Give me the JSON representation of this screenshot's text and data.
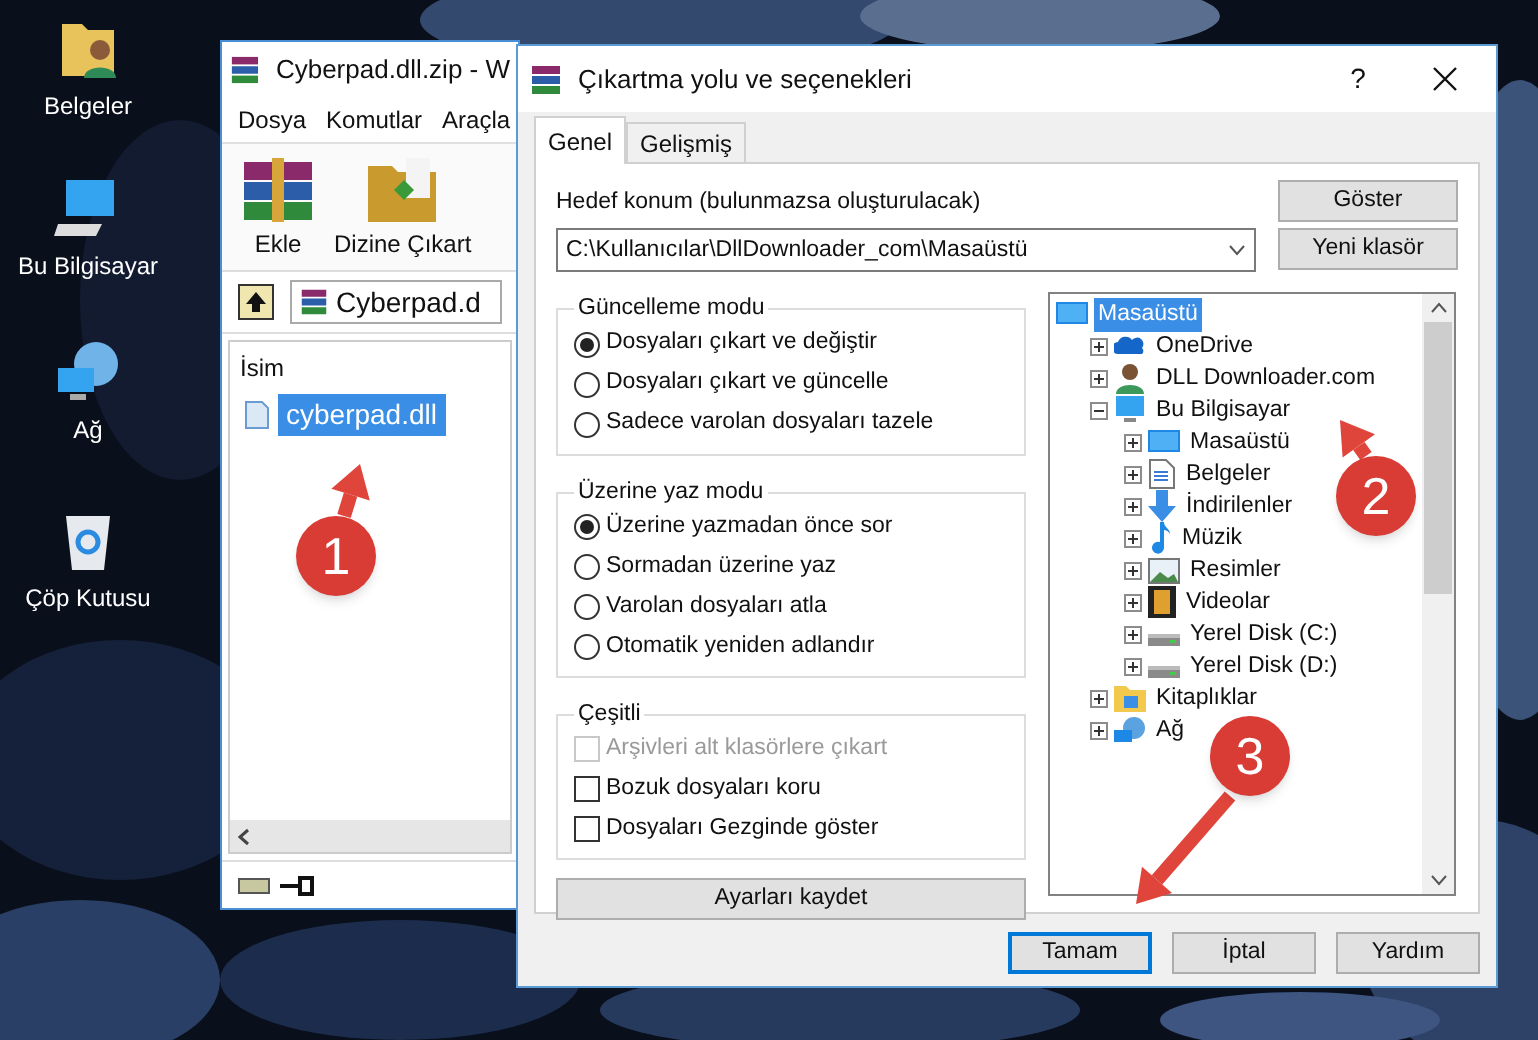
{
  "desktop_icons": [
    {
      "label": "Belgeler",
      "kind": "documents"
    },
    {
      "label": "Bu Bilgisayar",
      "kind": "computer"
    },
    {
      "label": "Ağ",
      "kind": "network"
    },
    {
      "label": "Çöp Kutusu",
      "kind": "recycle"
    }
  ],
  "archiver": {
    "title": "Cyberpad.dll.zip - W",
    "menu": [
      "Dosya",
      "Komutlar",
      "Araçla"
    ],
    "toolbar": [
      {
        "label": "Ekle",
        "kind": "add"
      },
      {
        "label": "Dizine Çıkart",
        "kind": "extract"
      }
    ],
    "path": "Cyberpad.d",
    "columns": [
      "İsim"
    ],
    "files": [
      {
        "name": "cyberpad.dll",
        "selected": true
      }
    ]
  },
  "dialog": {
    "title": "Çıkartma yolu ve seçenekleri",
    "help": "?",
    "tabs": [
      {
        "label": "Genel",
        "selected": true
      },
      {
        "label": "Gelişmiş",
        "selected": false
      }
    ],
    "destination": {
      "label": "Hedef konum (bulunmazsa oluşturulacak)",
      "value": "C:\\Kullanıcılar\\DllDownloader_com\\Masaüstü"
    },
    "side_buttons": [
      "Göster",
      "Yeni klasör"
    ],
    "groups": [
      {
        "title": "Güncelleme modu",
        "kind": "radio",
        "options": [
          {
            "label": "Dosyaları çıkart ve değiştir",
            "selected": true
          },
          {
            "label": "Dosyaları çıkart ve güncelle",
            "selected": false
          },
          {
            "label": "Sadece varolan dosyaları tazele",
            "selected": false
          }
        ]
      },
      {
        "title": "Üzerine yaz modu",
        "kind": "radio",
        "options": [
          {
            "label": "Üzerine yazmadan önce sor",
            "selected": true
          },
          {
            "label": "Sormadan üzerine yaz",
            "selected": false
          },
          {
            "label": "Varolan dosyaları atla",
            "selected": false
          },
          {
            "label": "Otomatik yeniden adlandır",
            "selected": false
          }
        ]
      },
      {
        "title": "Çeşitli",
        "kind": "checkbox",
        "options": [
          {
            "label": "Arşivleri alt klasörlere çıkart",
            "checked": false,
            "disabled": true
          },
          {
            "label": "Bozuk dosyaları koru",
            "checked": false,
            "disabled": false
          },
          {
            "label": "Dosyaları Gezginde göster",
            "checked": false,
            "disabled": false
          }
        ]
      }
    ],
    "save_button": "Ayarları kaydet",
    "tree": {
      "label": "Masaüstü",
      "kind": "desktop",
      "selected": true,
      "children": [
        {
          "label": "OneDrive",
          "kind": "cloud",
          "selected": false,
          "expanded": false
        },
        {
          "label": "DLL Downloader.com",
          "kind": "user",
          "selected": false,
          "expanded": false
        },
        {
          "label": "Bu Bilgisayar",
          "kind": "computer",
          "selected": false,
          "expanded": true,
          "children": [
            {
              "label": "Masaüstü",
              "kind": "desktop",
              "selected": false,
              "expanded": false
            },
            {
              "label": "Belgeler",
              "kind": "document",
              "selected": false,
              "expanded": false
            },
            {
              "label": "İndirilenler",
              "kind": "download",
              "selected": false,
              "expanded": false
            },
            {
              "label": "Müzik",
              "kind": "music",
              "selected": false,
              "expanded": false
            },
            {
              "label": "Resimler",
              "kind": "pictures",
              "selected": false,
              "expanded": false
            },
            {
              "label": "Videolar",
              "kind": "video",
              "selected": false,
              "expanded": false
            },
            {
              "label": "Yerel Disk (C:)",
              "kind": "drive",
              "selected": false,
              "expanded": false
            },
            {
              "label": "Yerel Disk (D:)",
              "kind": "drive",
              "selected": false,
              "expanded": false
            }
          ]
        },
        {
          "label": "Kitaplıklar",
          "kind": "folder",
          "selected": false,
          "expanded": false
        },
        {
          "label": "Ağ",
          "kind": "network",
          "selected": false,
          "expanded": false
        }
      ]
    },
    "buttons": [
      {
        "label": "Tamam",
        "focused": true
      },
      {
        "label": "İptal",
        "focused": false
      },
      {
        "label": "Yardım",
        "focused": false
      }
    ]
  },
  "annotations": [
    {
      "number": "1"
    },
    {
      "number": "2"
    },
    {
      "number": "3"
    }
  ]
}
